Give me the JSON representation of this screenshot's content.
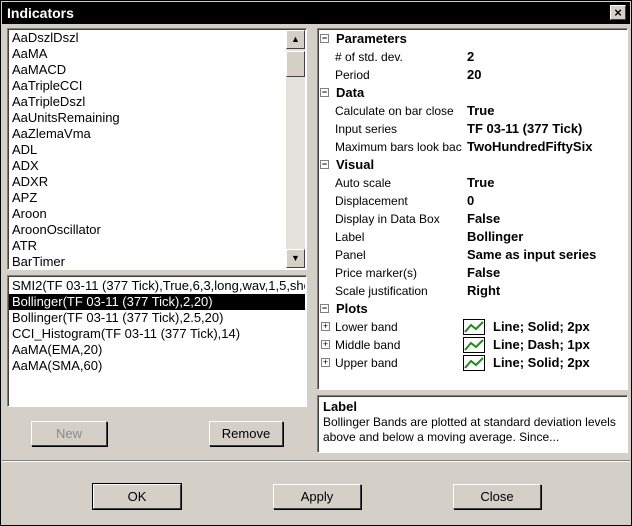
{
  "window": {
    "title": "Indicators",
    "close_glyph": "×"
  },
  "indicator_list": {
    "items": [
      "AaDszlDszl",
      "AaMA",
      "AaMACD",
      "AaTripleCCI",
      "AaTripleDszl",
      "AaUnitsRemaining",
      "AaZlemaVma",
      "ADL",
      "ADX",
      "ADXR",
      "APZ",
      "Aroon",
      "AroonOscillator",
      "ATR",
      "BarTimer"
    ]
  },
  "applied_list": {
    "items": [
      "SMI2(TF 03-11 (377 Tick),True,6,3,long,wav,1,5,sho",
      "Bollinger(TF 03-11 (377 Tick),2,20)",
      "Bollinger(TF 03-11 (377 Tick),2.5,20)",
      "CCI_Histogram(TF 03-11 (377 Tick),14)",
      "AaMA(EMA,20)",
      "AaMA(SMA,60)"
    ],
    "selected_index": 1
  },
  "buttons": {
    "new": "New",
    "remove": "Remove",
    "ok": "OK",
    "apply": "Apply",
    "close": "Close"
  },
  "properties": {
    "parameters": {
      "label": "Parameters",
      "rows": [
        {
          "name": "# of std. dev.",
          "value": "2"
        },
        {
          "name": "Period",
          "value": "20"
        }
      ]
    },
    "data": {
      "label": "Data",
      "rows": [
        {
          "name": "Calculate on bar close",
          "value": "True"
        },
        {
          "name": "Input series",
          "value": "TF 03-11 (377 Tick)"
        },
        {
          "name": "Maximum bars look back",
          "value": "TwoHundredFiftySix"
        }
      ]
    },
    "visual": {
      "label": "Visual",
      "rows": [
        {
          "name": "Auto scale",
          "value": "True"
        },
        {
          "name": "Displacement",
          "value": "0"
        },
        {
          "name": "Display in Data Box",
          "value": "False"
        },
        {
          "name": "Label",
          "value": "Bollinger"
        },
        {
          "name": "Panel",
          "value": "Same as input series"
        },
        {
          "name": "Price marker(s)",
          "value": "False"
        },
        {
          "name": "Scale justification",
          "value": "Right"
        }
      ]
    },
    "plots": {
      "label": "Plots",
      "rows": [
        {
          "name": "Lower band",
          "value": "Line; Solid; 2px"
        },
        {
          "name": "Middle band",
          "value": "Line; Dash; 1px"
        },
        {
          "name": "Upper band",
          "value": "Line; Solid; 2px"
        }
      ]
    }
  },
  "description": {
    "title": "Label",
    "text": "Bollinger Bands are plotted at standard deviation levels above and below a moving average. Since..."
  },
  "colors": {
    "plot_line": "#1e8c1e"
  }
}
